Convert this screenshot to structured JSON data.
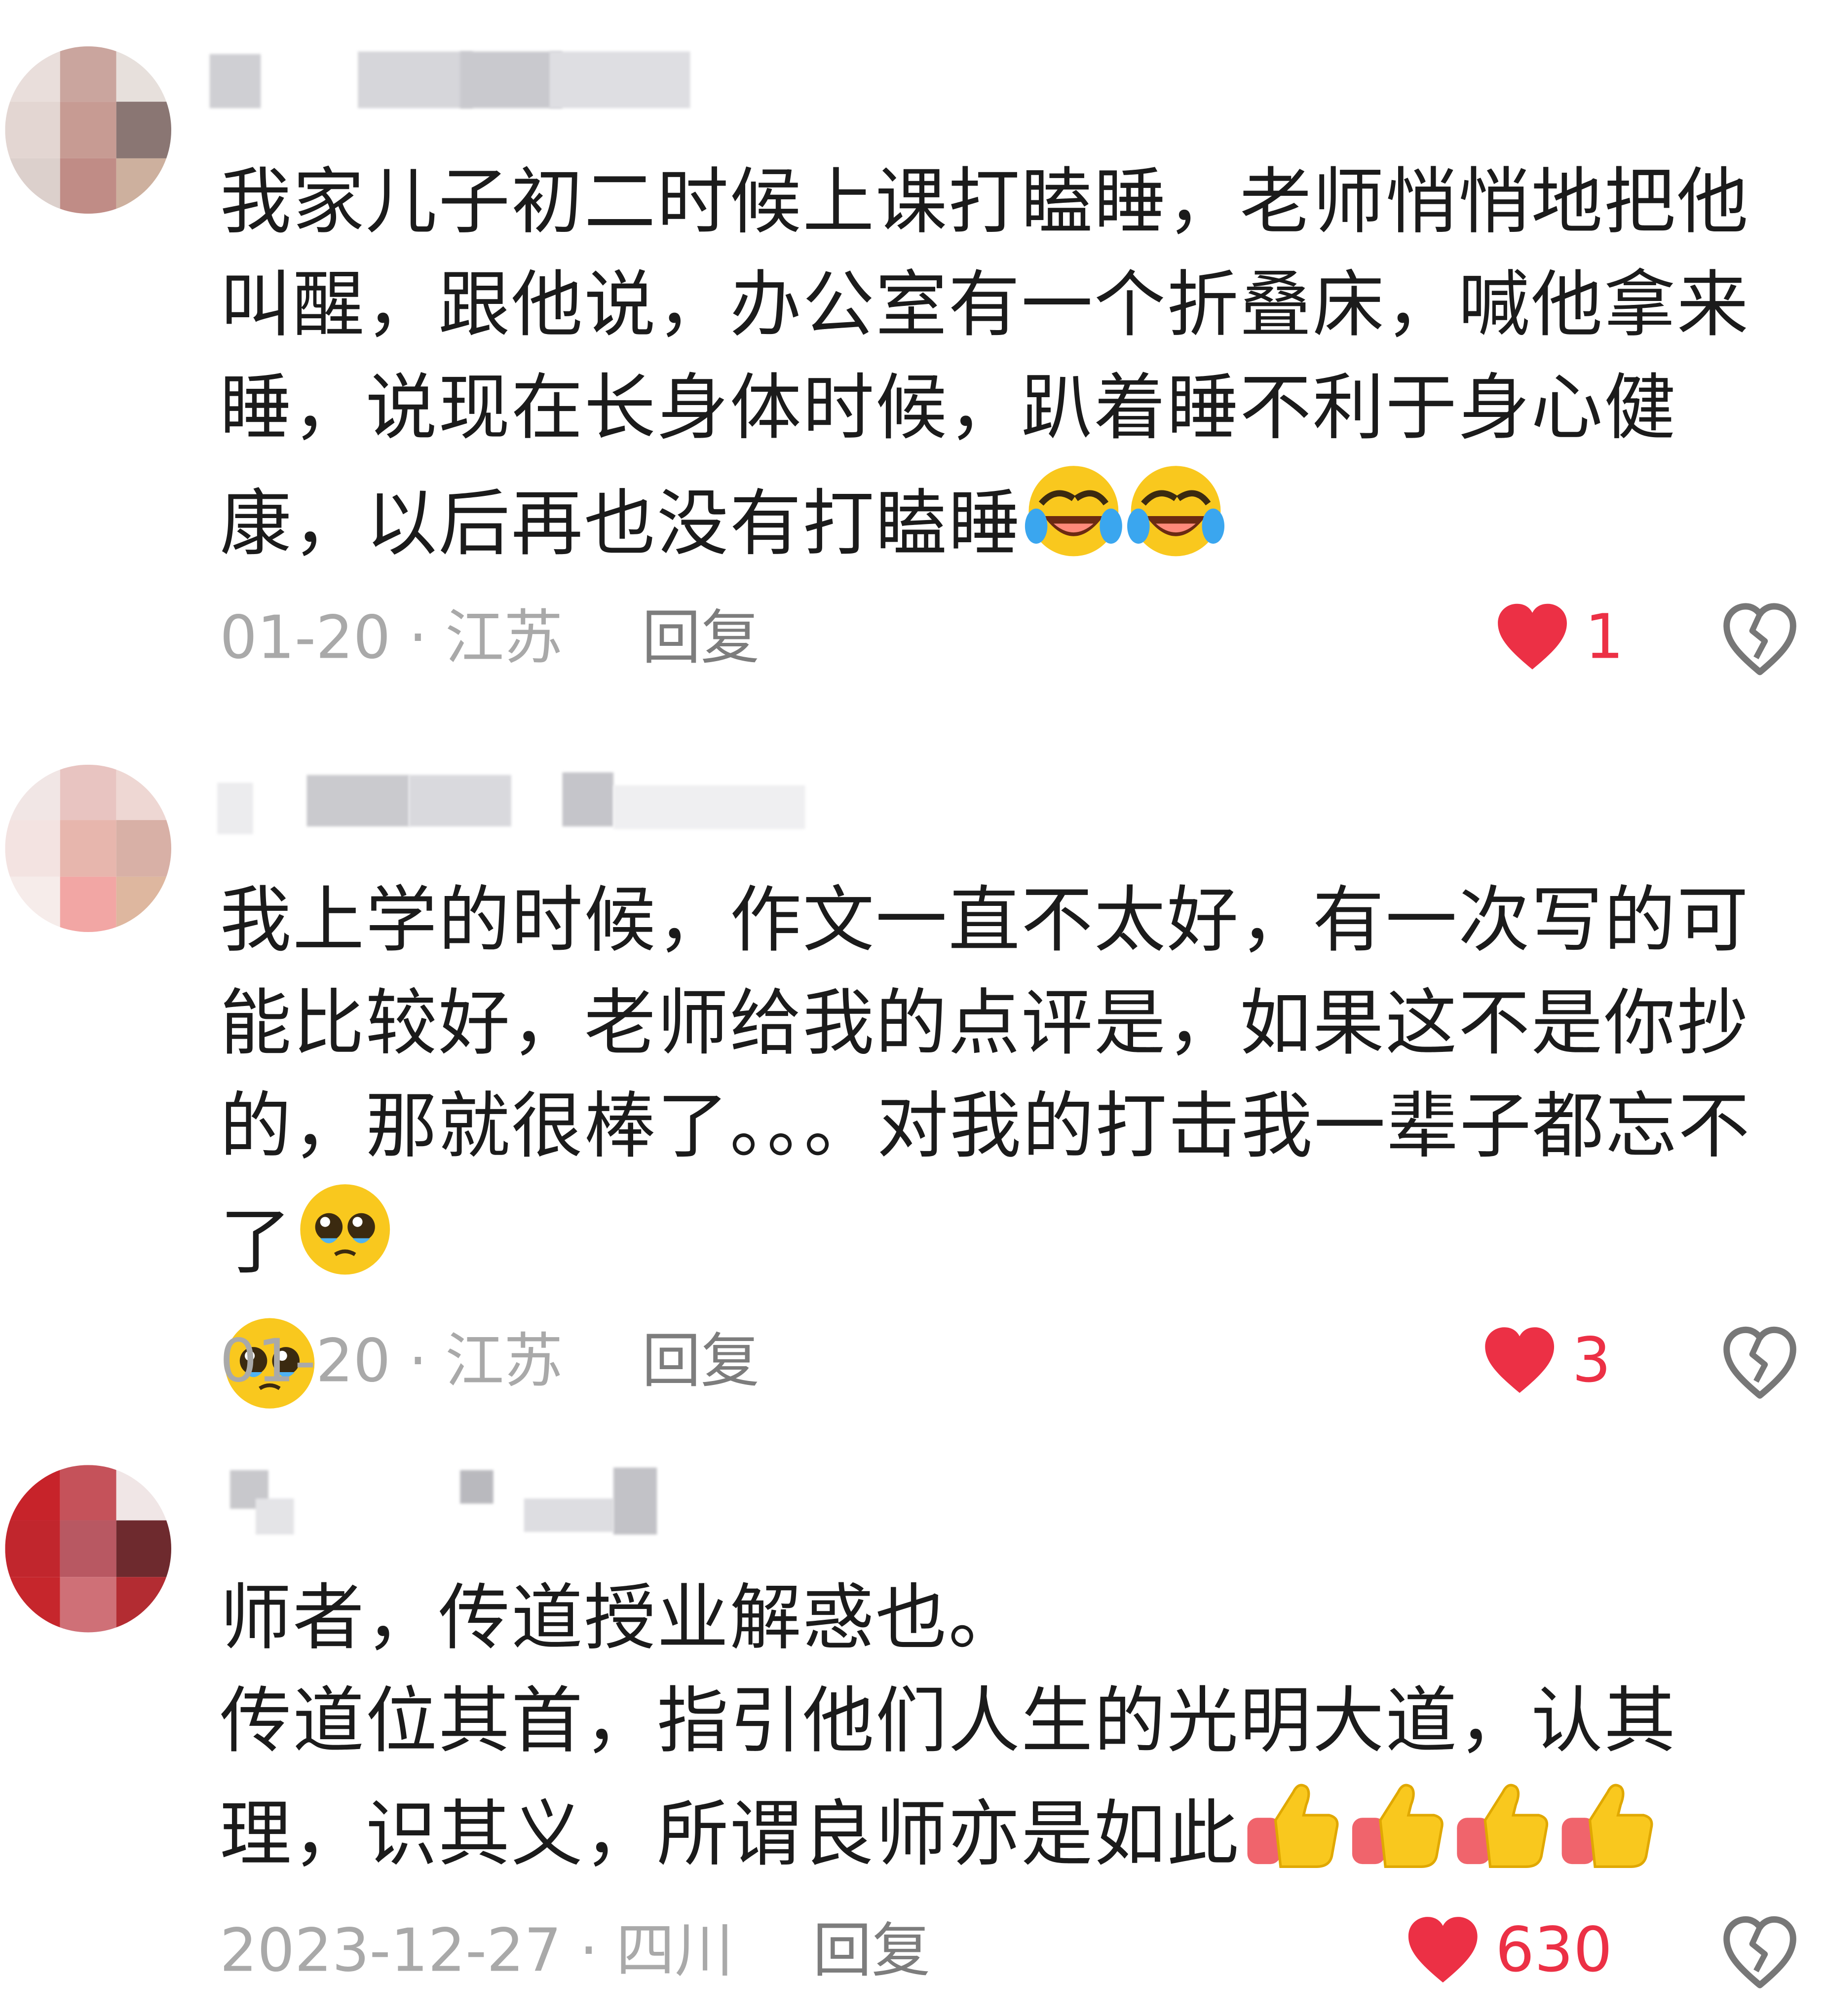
{
  "comments": [
    {
      "text": "我家儿子初二时候上课打瞌睡，老师悄悄地把他叫醒，跟他说，办公室有一个折叠床，喊他拿来睡，说现在长身体时候，趴着睡不利于身心健康，以后再也没有打瞌睡",
      "emojis": [
        "laughing-crying-emoji",
        "laughing-crying-emoji"
      ],
      "date": "01-20",
      "location": "江苏",
      "reply_label": "回复",
      "likes": "1"
    },
    {
      "text": "我上学的时候，作文一直不太好，有一次写的可能比较好，老师给我的点评是，如果这不是你抄的，那就很棒了。。。对我的打击我一辈子都忘不了",
      "emojis": [
        "pleading-face-emoji",
        "pleading-face-emoji"
      ],
      "date": "01-20",
      "location": "江苏",
      "reply_label": "回复",
      "likes": "3"
    },
    {
      "text": "师者，传道授业解惑也。\n传道位其首，指引他们人生的光明大道，认其理，识其义，所谓良师亦是如此",
      "emojis": [
        "thumbs-up-emoji",
        "thumbs-up-emoji",
        "thumbs-up-emoji",
        "thumbs-up-emoji"
      ],
      "date": "2023-12-27",
      "location": "四川",
      "reply_label": "回复",
      "likes": "630"
    }
  ],
  "separator": "·",
  "icons": {
    "like": "heart-icon",
    "dislike": "broken-heart-icon"
  },
  "colors": {
    "like": "#ec3045",
    "meta": "#a9a9a9",
    "reply": "#7d7d7d"
  }
}
